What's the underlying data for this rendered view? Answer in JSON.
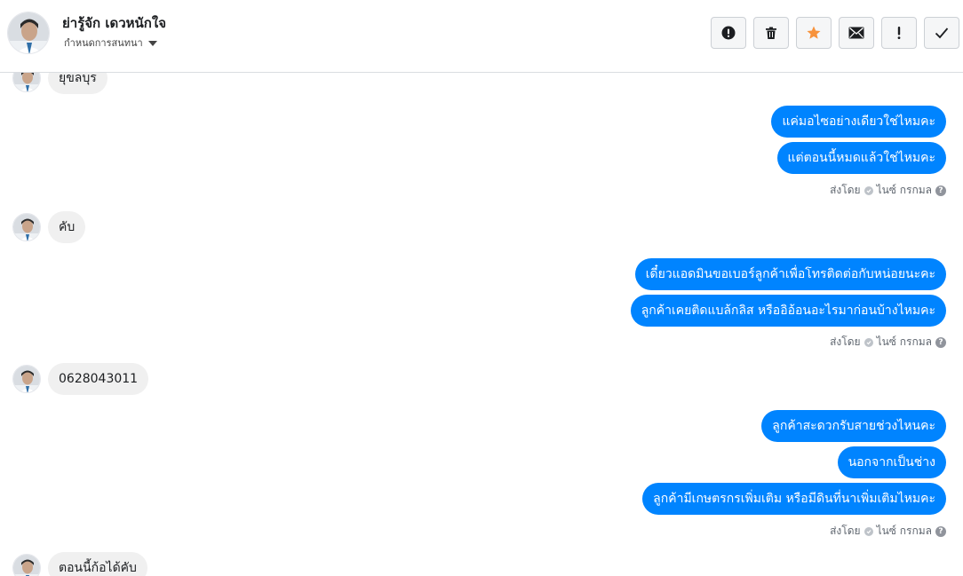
{
  "header": {
    "contact_name": "ย่ารู้จัก เดวหนักใจ",
    "assign_label": "กำหนดการสนทนา",
    "actions": [
      {
        "icon": "alert-circle-icon",
        "label": "Mark as spam"
      },
      {
        "icon": "trash-icon",
        "label": "Delete"
      },
      {
        "icon": "star-icon",
        "label": "Star"
      },
      {
        "icon": "mail-icon",
        "label": "Mark unread"
      },
      {
        "icon": "exclamation-icon",
        "label": "Follow up"
      },
      {
        "icon": "check-icon",
        "label": "Done"
      }
    ]
  },
  "colors": {
    "accent": "#0084ff",
    "star": "#f7923b",
    "incoming_bg": "#f0f0f0"
  },
  "messages": {
    "in1": "ยุขลบุร",
    "out1": [
      "แค่มอไซอย่างเดียวใช่ไหมคะ",
      "แต่ตอนนี้หมดแล้วใช่ไหมคะ"
    ],
    "in2": "คับ",
    "out2": [
      "เดี๋ยวแอดมินขอเบอร์ลูกค้าเพื่อโทรติดต่อกับหน่อยนะคะ",
      "ลูกค้าเคยติดแบล้กลิส หรืออิอ้อนอะไรมาก่อนบ้างไหมคะ"
    ],
    "in3": "0628043011",
    "out3": [
      "ลูกค้าสะดวกรับสายช่วงไหนคะ",
      "นอกจากเป็นช่าง",
      "ลูกค้ามีเกษตรกรเพิ่มเติม หรือมีดินที่นาเพิ่มเติมไหมคะ"
    ],
    "in4": "ตอนนี้ก้อได้คับ"
  },
  "sent_meta": {
    "prefix": "ส่งโดย",
    "sender": "ไนซ์ กรกมล",
    "help": "?"
  }
}
